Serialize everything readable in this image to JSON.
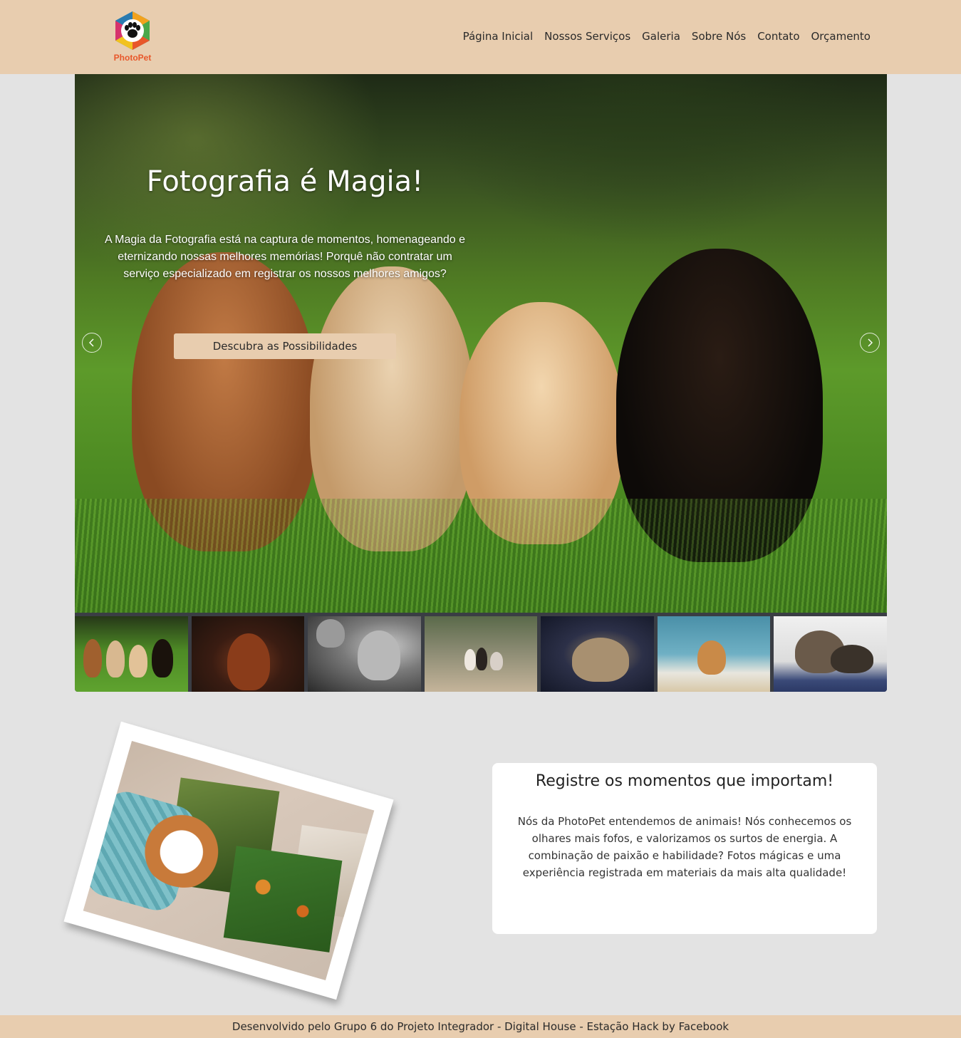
{
  "brand": {
    "name": "PhotoPet",
    "logo_icon": "paw-hexagon-icon",
    "accent": "#e8572a"
  },
  "nav": {
    "items": [
      {
        "label": "Página Inicial"
      },
      {
        "label": "Nossos Serviços"
      },
      {
        "label": "Galeria"
      },
      {
        "label": "Sobre Nós"
      },
      {
        "label": "Contato"
      },
      {
        "label": "Orçamento"
      }
    ]
  },
  "hero": {
    "title": "Fotografia é Magia!",
    "text": "A Magia da Fotografia está na captura de momentos, homenageando e eternizando nossas melhores memórias! Porquê não contratar um serviço especializado em registrar os nossos melhores amigos?",
    "button_label": "Descubra as Possibilidades",
    "prev_icon": "chevron-left-icon",
    "next_icon": "chevron-right-icon"
  },
  "thumbnails": [
    {
      "subject": "four dogs on grass"
    },
    {
      "subject": "brown dog dark background"
    },
    {
      "subject": "grey cat black and white"
    },
    {
      "subject": "dogs on path"
    },
    {
      "subject": "tabby cat dark background"
    },
    {
      "subject": "dog running on beach"
    },
    {
      "subject": "kitten on blanket"
    }
  ],
  "about": {
    "title": "Registre os momentos que importam!",
    "text": "Nós da PhotoPet entendemos de animais! Nós conhecemos os olhares mais fofos, e valorizamos os surtos de energia. A combinação de paixão e habilidade? Fotos mágicas e uma experiência registrada em materiais da mais alta qualidade!"
  },
  "footer": {
    "text": "Desenvolvido pelo Grupo 6 do Projeto Integrador - Digital House - Estação Hack by Facebook"
  },
  "colors": {
    "header_bg": "#e8cdaf",
    "page_bg": "#e3e3e3",
    "card_bg": "#ffffff"
  }
}
